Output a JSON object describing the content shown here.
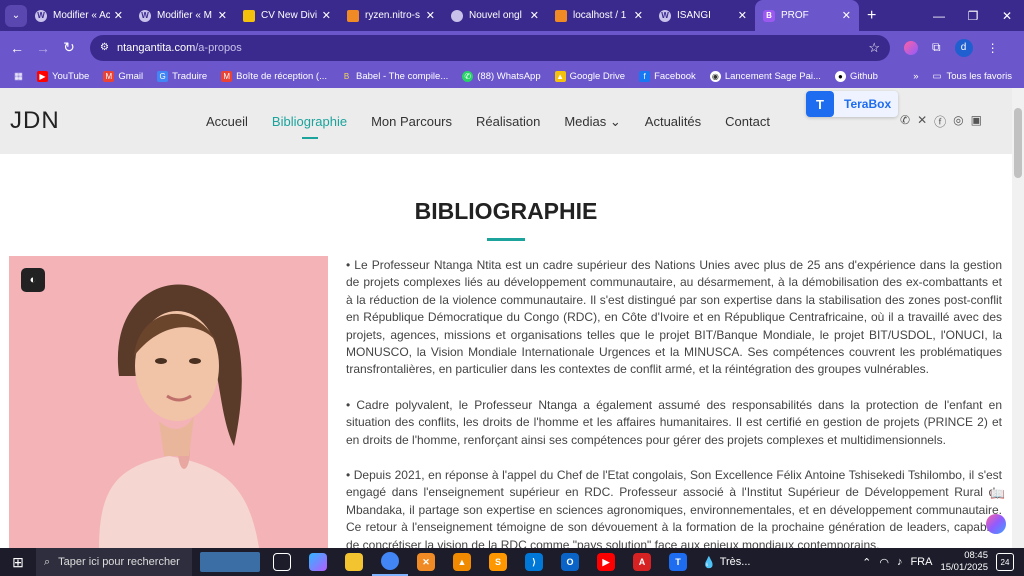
{
  "browser": {
    "tabs": [
      {
        "title": "Modifier « Ac",
        "icon": "wordpress-icon"
      },
      {
        "title": "Modifier « M",
        "icon": "wordpress-icon"
      },
      {
        "title": "CV New Divi",
        "icon": "google-drive-icon"
      },
      {
        "title": "ryzen.nitro-s",
        "icon": "xampp-icon"
      },
      {
        "title": "Nouvel ongl",
        "icon": "chrome-icon"
      },
      {
        "title": "localhost / 1",
        "icon": "xampp-icon"
      },
      {
        "title": "ISANGI",
        "icon": "wordpress-icon"
      },
      {
        "title": "PROF",
        "icon": "site-icon",
        "active": true
      }
    ],
    "favicon_letter": "B",
    "url_host": "ntangantita.com",
    "url_path": "/a-propos",
    "profile_initial": "d",
    "bookmarks": [
      "YouTube",
      "Gmail",
      "Traduire",
      "Boîte de réception (...",
      "Babel - The compile...",
      "(88) WhatsApp",
      "Google Drive",
      "Facebook",
      "Lancement Sage Pai...",
      "Github"
    ],
    "bookmarks_all": "Tous les favoris",
    "more": "»"
  },
  "site": {
    "logo": "JDN",
    "nav": [
      "Accueil",
      "Bibliographie",
      "Mon Parcours",
      "Réalisation",
      "Medias",
      "Actualités",
      "Contact"
    ],
    "medias_chevron": "⌄",
    "terabox": "TeraBox"
  },
  "content": {
    "title": "BIBLIOGRAPHIE",
    "paragraphs": [
      "• Le Professeur Ntanga Ntita est un cadre supérieur des Nations Unies avec plus de 25 ans d'expérience dans la gestion de projets complexes liés au développement communautaire, au désarmement, à la démobilisation des ex-combattants et à la réduction de la violence communautaire. Il s'est distingué par son expertise dans la stabilisation des zones post-conflit en République Démocratique du Congo (RDC), en Côte d'Ivoire et en République Centrafricaine, où il a travaillé avec des projets, agences, missions et organisations telles que le projet BIT/Banque Mondiale, le projet BIT/USDOL, l'ONUCI, la MONUSCO, la Vision Mondiale Internationale Urgences et la MINUSCA. Ses compétences couvrent les problématiques transfrontalières, en particulier dans les contextes de conflit armé, et la réintégration des groupes vulnérables.",
      "• Cadre polyvalent, le Professeur Ntanga a également assumé des responsabilités dans la protection de l'enfant en situation des conflits, les droits de l'homme et les affaires humanitaires. Il est certifié en gestion de projets (PRINCE 2) et en droits de l'homme, renforçant ainsi ses compétences pour gérer des projets complexes et multidimensionnels.",
      "• Depuis 2021, en réponse à l'appel du Chef de l'Etat congolais, Son Excellence Félix Antoine Tshisekedi Tshilombo, il s'est engagé dans l'enseignement supérieur en RDC. Professeur associé à l'Institut Supérieur de Développement Rural de Mbandaka, il partage son expertise en sciences agronomiques, environnementales, et en développement communautaire. Ce retour à l'enseignement témoigne de son dévouement à la formation de la prochaine génération de leaders, capables de concrétiser la vision de la RDC comme \"pays solution\" face aux enjeux mondiaux contemporains."
    ]
  },
  "taskbar": {
    "search_placeholder": "Taper ici pour rechercher",
    "weather": "Très...",
    "lang": "FRA",
    "time": "08:45",
    "date": "15/01/2025",
    "notifications": "24"
  }
}
